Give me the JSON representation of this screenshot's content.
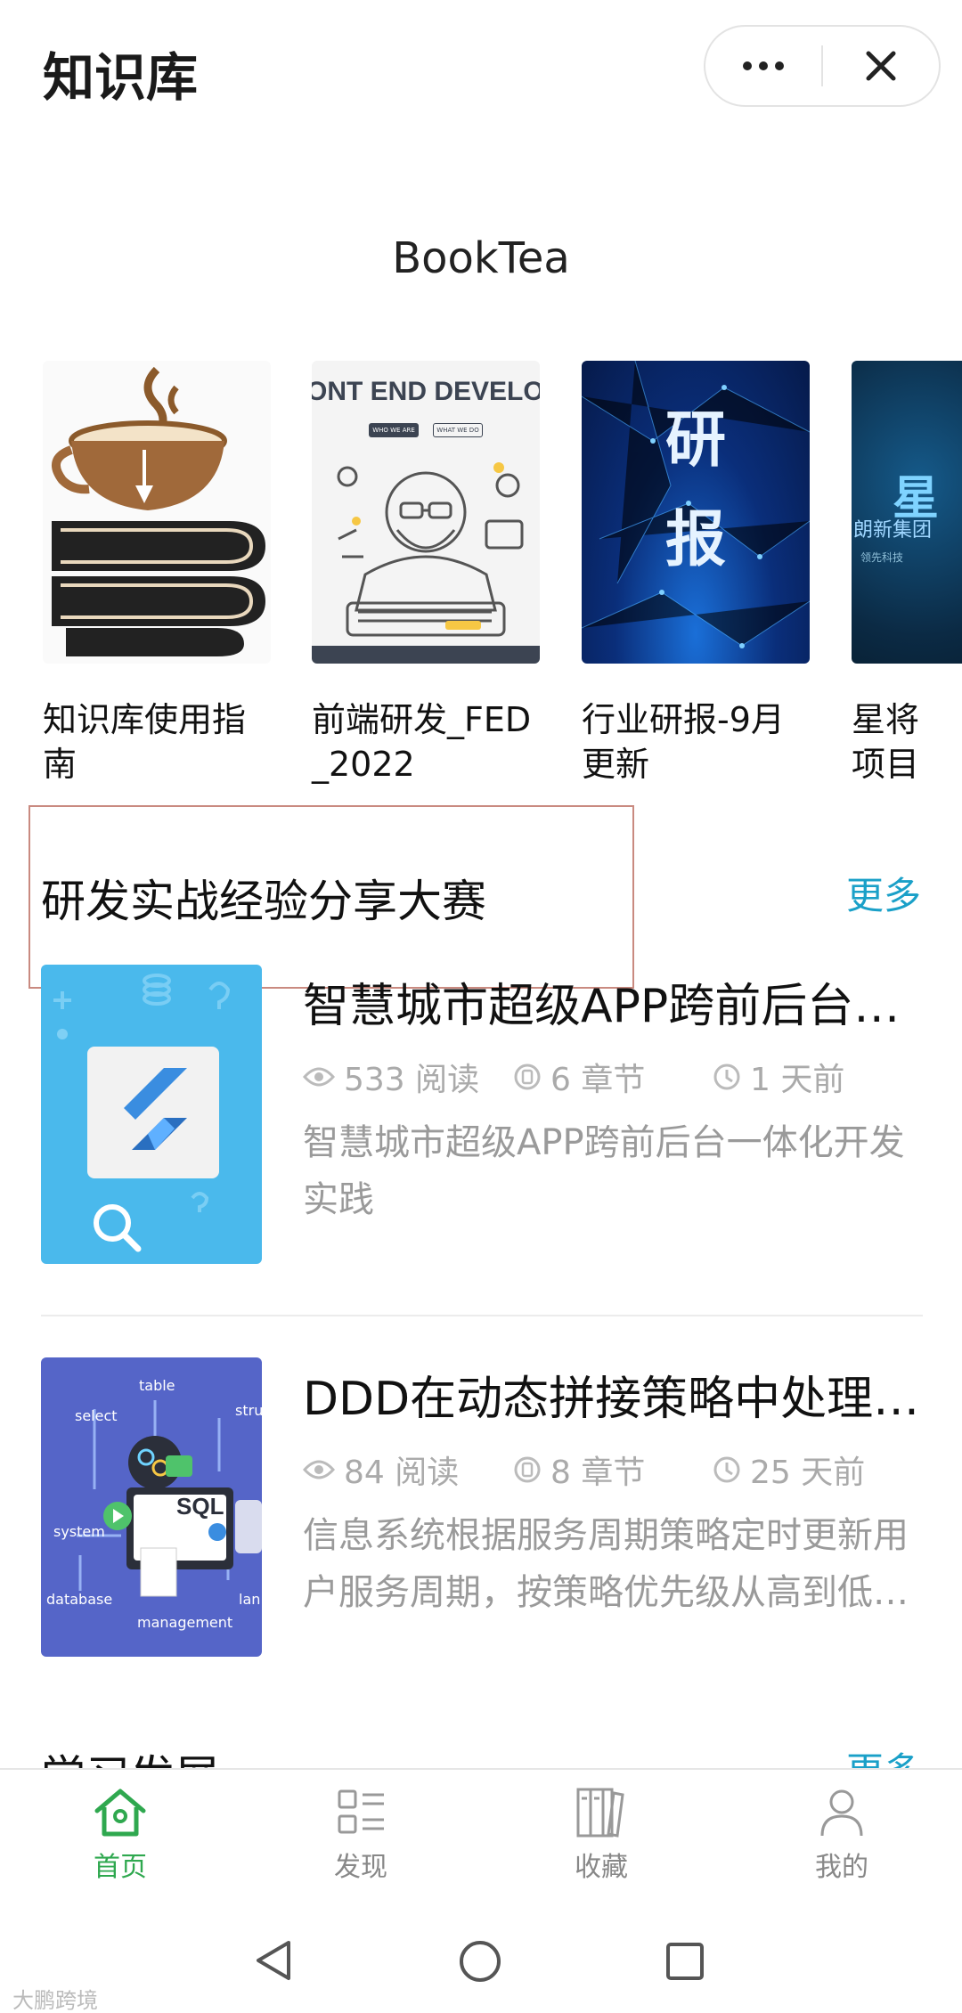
{
  "app": {
    "title": "知识库"
  },
  "brand": "BookTea",
  "books": [
    {
      "title": "知识库使用指南"
    },
    {
      "title": "前端研发_FED_2022",
      "cover_text": "ONT END DEVELOPM",
      "cover_buttons": [
        "WHO WE ARE",
        "WHAT WE DO"
      ]
    },
    {
      "title": "行业研报-9月更新",
      "cover_text": "研报"
    },
    {
      "title": "星将项目",
      "cover_text": "星",
      "cover_sub": "朗新集团",
      "cover_small": "领先科技"
    }
  ],
  "section": {
    "title": "研发实战经验分享大赛",
    "more": "更多"
  },
  "articles": [
    {
      "title": "智慧城市超级APP跨前后台一体化开发实践",
      "reads": "533 阅读",
      "chapters": "6 章节",
      "time": "1 天前",
      "desc": "智慧城市超级APP跨前后台一体化开发实践"
    },
    {
      "title": "DDD在动态拼接策略中处理用户服务周期",
      "reads": "84 阅读",
      "chapters": "8 章节",
      "time": "25 天前",
      "desc": "信息系统根据服务周期策略定时更新用户服务周期，按策略优先级从高到低依次处理",
      "thumb_words": [
        "table",
        "select",
        "stru",
        "system",
        "SQL",
        "database",
        "lan",
        "management"
      ]
    }
  ],
  "next_section": {
    "title": "学习发展",
    "more": "更多"
  },
  "tabs": [
    {
      "label": "首页",
      "icon": "home-icon",
      "active": true
    },
    {
      "label": "发现",
      "icon": "discover-icon",
      "active": false
    },
    {
      "label": "收藏",
      "icon": "books-icon",
      "active": false
    },
    {
      "label": "我的",
      "icon": "user-icon",
      "active": false
    }
  ],
  "watermark": "大鹏跨境",
  "colors": {
    "accent": "#1aa0c8",
    "active_tab": "#2fa84f",
    "anno_box": "#c98a80"
  }
}
